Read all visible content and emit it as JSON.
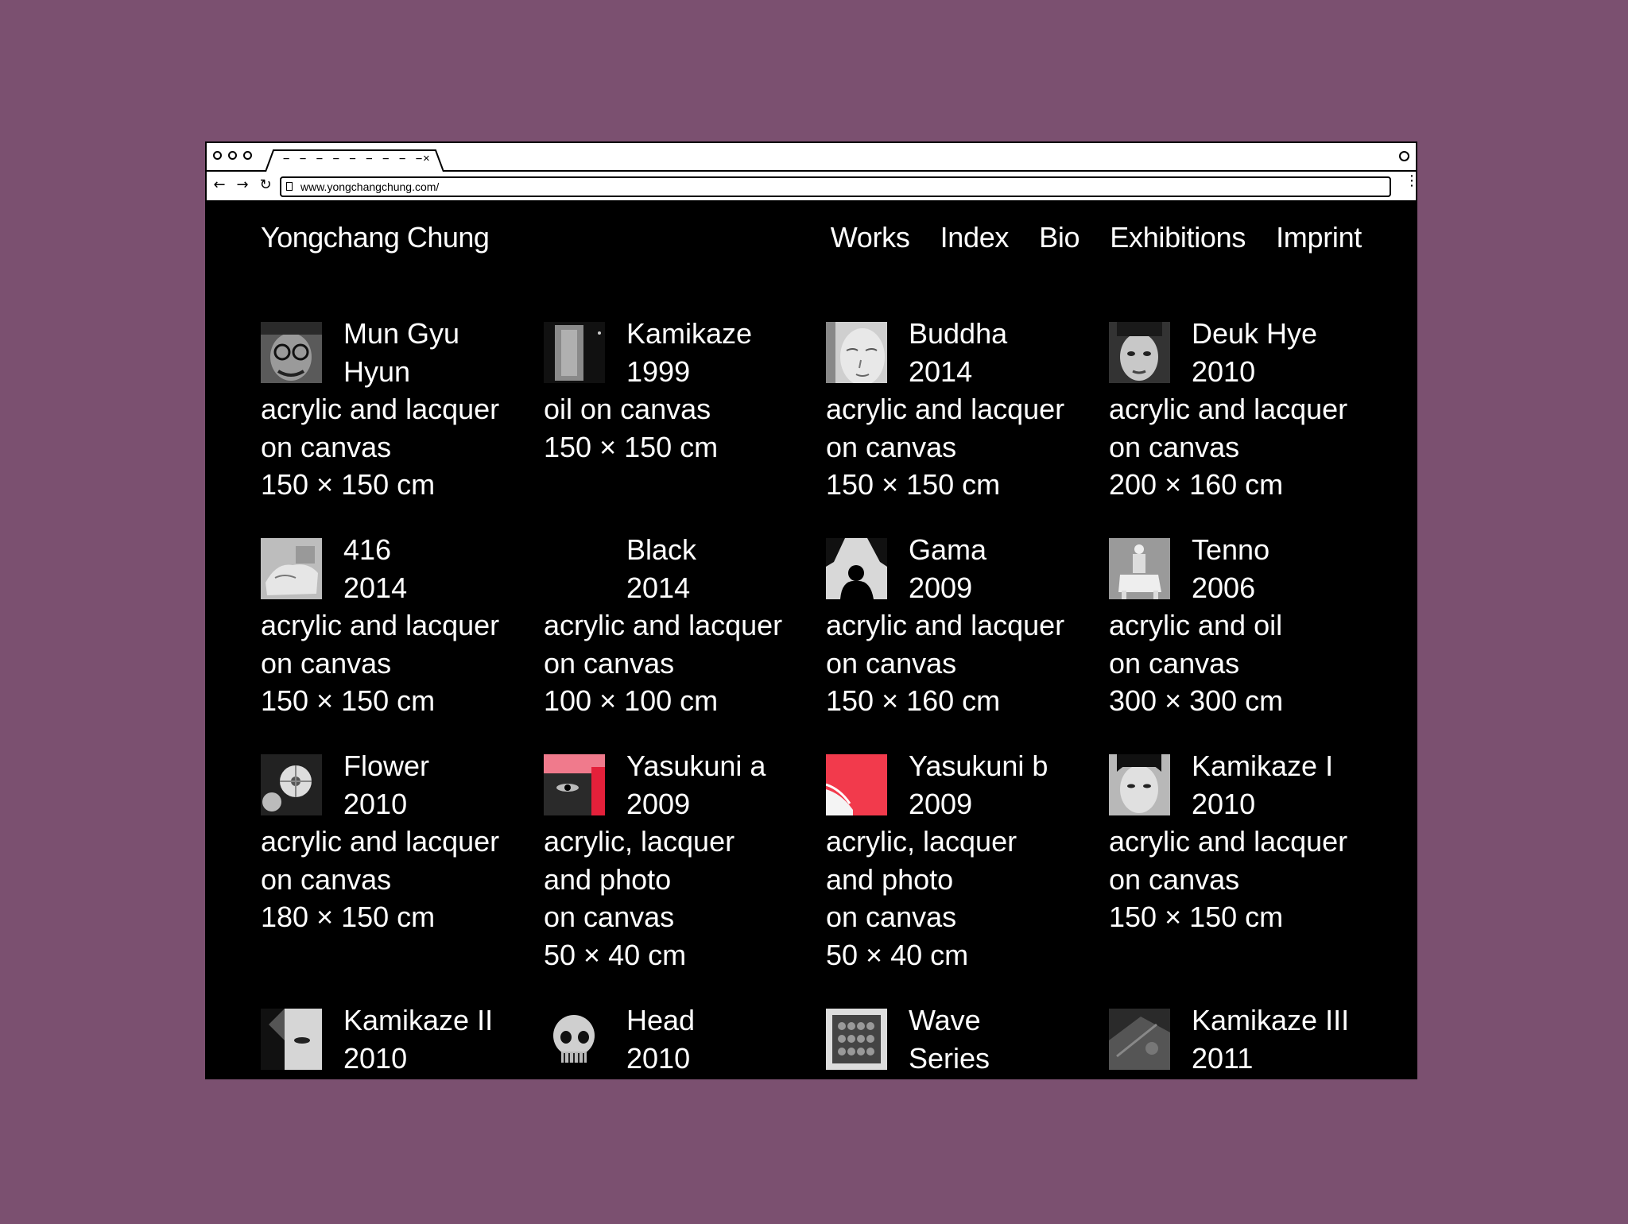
{
  "browser": {
    "tab_title": "− − − − − − − − −",
    "tab_close": "×",
    "url": "www.yongchangchung.com/",
    "back_icon": "←",
    "forward_icon": "→",
    "reload_icon": "↻",
    "menu_icon": "⋮"
  },
  "site": {
    "title": "Yongchang Chung",
    "nav": [
      "Works",
      "Index",
      "Bio",
      "Exhibitions",
      "Imprint"
    ]
  },
  "works": [
    {
      "title": "Mun Gyu",
      "title2": "Hyun",
      "year": "",
      "medium": "acrylic and lacquer\non canvas",
      "size": "150 × 150 cm",
      "thumb": "portrait-glasses"
    },
    {
      "title": "Kamikaze",
      "title2": "",
      "year": "1999",
      "medium": "oil on canvas",
      "size": "150 × 150 cm",
      "thumb": "grey-abstract"
    },
    {
      "title": "Buddha",
      "title2": "",
      "year": "2014",
      "medium": "acrylic and lacquer\non canvas",
      "size": "150 × 150 cm",
      "thumb": "buddha-face"
    },
    {
      "title": "Deuk Hye",
      "title2": "",
      "year": "2010",
      "medium": "acrylic and lacquer\non canvas",
      "size": "200 × 160 cm",
      "thumb": "woman-portrait"
    },
    {
      "title": "416",
      "title2": "",
      "year": "2014",
      "medium": "acrylic and lacquer\non canvas",
      "size": "150 × 150 cm",
      "thumb": "hand"
    },
    {
      "title": "Black",
      "title2": "",
      "year": "2014",
      "medium": "acrylic and lacquer\non canvas",
      "size": "100 × 100 cm",
      "thumb": "black"
    },
    {
      "title": "Gama",
      "title2": "",
      "year": "2009",
      "medium": "acrylic and lacquer\non canvas",
      "size": "150 × 160 cm",
      "thumb": "silhouette"
    },
    {
      "title": "Tenno",
      "title2": "",
      "year": "2006",
      "medium": "acrylic and oil\non canvas",
      "size": "300 × 300 cm",
      "thumb": "horse-rider"
    },
    {
      "title": "Flower",
      "title2": "",
      "year": "2010",
      "medium": "acrylic and lacquer\non canvas",
      "size": "180 × 150 cm",
      "thumb": "flower"
    },
    {
      "title": "Yasukuni a",
      "title2": "",
      "year": "2009",
      "medium": "acrylic, lacquer\nand photo\non canvas",
      "size": "50 × 40 cm",
      "thumb": "red-eyes"
    },
    {
      "title": "Yasukuni b",
      "title2": "",
      "year": "2009",
      "medium": "acrylic, lacquer\nand photo\non canvas",
      "size": "50 × 40 cm",
      "thumb": "red-white"
    },
    {
      "title": "Kamikaze I",
      "title2": "",
      "year": "2010",
      "medium": "acrylic and lacquer\non canvas",
      "size": "150 × 150 cm",
      "thumb": "boy-portrait"
    },
    {
      "title": "Kamikaze II",
      "title2": "",
      "year": "2010",
      "medium": "",
      "size": "",
      "thumb": "face-closeup"
    },
    {
      "title": "Head",
      "title2": "",
      "year": "2010",
      "medium": "",
      "size": "",
      "thumb": "skull"
    },
    {
      "title": "Wave",
      "title2": "",
      "year": "Series",
      "medium": "",
      "size": "",
      "thumb": "wave-grid"
    },
    {
      "title": "Kamikaze III",
      "title2": "",
      "year": "2011",
      "medium": "",
      "size": "",
      "thumb": "dark-texture"
    }
  ]
}
